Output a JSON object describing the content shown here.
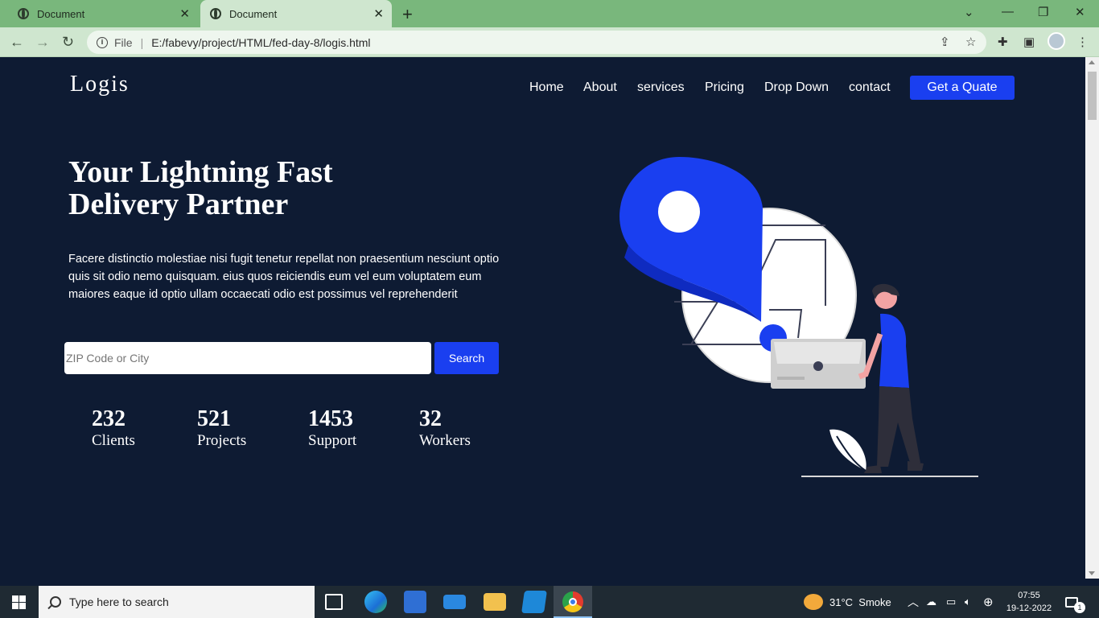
{
  "browser": {
    "tabs": [
      {
        "title": "Document"
      },
      {
        "title": "Document"
      }
    ],
    "address": {
      "label": "File",
      "url": "E:/fabevy/project/HTML/fed-day-8/logis.html"
    }
  },
  "site": {
    "logo": "Logis",
    "nav": [
      "Home",
      "About",
      "services",
      "Pricing",
      "Drop Down",
      "contact"
    ],
    "cta": "Get a Quate",
    "hero": {
      "title_line1": "Your Lightning Fast",
      "title_line2": "Delivery Partner",
      "text": "Facere distinctio molestiae nisi fugit tenetur repellat non praesentium nesciunt optio quis sit odio nemo quisquam. eius quos reiciendis eum vel eum voluptatem eum maiores eaque id optio ullam occaecati odio est possimus vel reprehenderit"
    },
    "search": {
      "placeholder": "ZIP Code or City",
      "button": "Search"
    },
    "stats": [
      {
        "value": "232",
        "label": "Clients"
      },
      {
        "value": "521",
        "label": "Projects"
      },
      {
        "value": "1453",
        "label": "Support"
      },
      {
        "value": "32",
        "label": "Workers"
      }
    ]
  },
  "taskbar": {
    "search_placeholder": "Type here to search",
    "weather": "31°C  Smoke",
    "time": "07:55",
    "date": "19-12-2022",
    "notification_count": "1"
  },
  "colors": {
    "background": "#0e1b33",
    "accent": "#1a3ff0",
    "tab_strip": "#79b77c"
  }
}
